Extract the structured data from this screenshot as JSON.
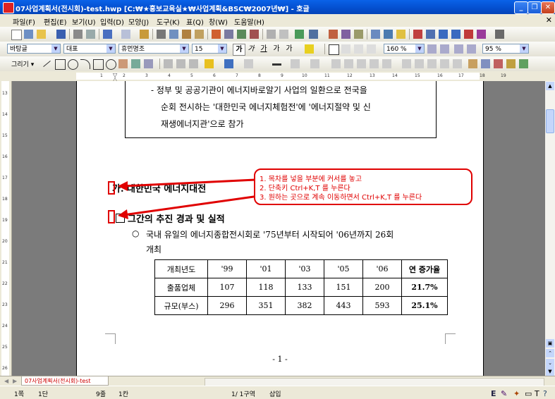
{
  "window": {
    "title": "07사업계획서(전시회)-test.hwp [C:₩★홍보교육실★₩사업계획&BSC₩2007년₩] - 호글"
  },
  "menu": [
    "파일(F)",
    "편집(E)",
    "보기(U)",
    "입력(D)",
    "모양(J)",
    "도구(K)",
    "표(Q)",
    "창(W)",
    "도움말(H)"
  ],
  "format_bar": {
    "style": "바탕글",
    "font_lang": "대표",
    "font_name": "휴먼명조",
    "font_size": "15",
    "line_spacing": "160 %",
    "zoom": "95 %"
  },
  "ruler_ticks": [
    "1",
    "2",
    "3",
    "4",
    "5",
    "6",
    "7",
    "8",
    "9",
    "10",
    "11",
    "12",
    "13",
    "14",
    "15",
    "16",
    "17",
    "18",
    "19"
  ],
  "vruler_ticks": [
    "13",
    "14",
    "15",
    "16",
    "17",
    "18",
    "19",
    "20",
    "21",
    "22",
    "23",
    "24",
    "25",
    "26"
  ],
  "document": {
    "box_text": [
      "- 정부 및 공공기관이 에너지바로알기 사업의 일환으로 전국을",
      "순회 전시하는 '대한민국 에너지체험전'에 '에너지절약 및 신",
      "재생에너지관'으로 참가"
    ],
    "heading_ga": "가. 대한민국 에너지대전",
    "heading_sub": "그간의 추진 경과 및 실적",
    "bullet": "○",
    "paragraph_line1": "국내 유일의 에너지종합전시회로 '75년부터 시작되어 '06년까지 26회",
    "paragraph_line2": "개최",
    "table": {
      "header": [
        "개최년도",
        "'99",
        "'01",
        "'03",
        "'05",
        "'06",
        "연 증가율"
      ],
      "rows": [
        [
          "출품업체",
          "107",
          "118",
          "133",
          "151",
          "200",
          "21.7%"
        ],
        [
          "규모(부스)",
          "296",
          "351",
          "382",
          "443",
          "593",
          "25.1%"
        ]
      ]
    },
    "page_number": "- 1 -"
  },
  "callout": {
    "lines": [
      "1. 목차를 넣을 부분에 커서를 놓고",
      "2. 단축키 Ctrl+K,T 를 누른다",
      "3. 원하는 곳으로 계속 이동하면서 Ctrl+K,T 를 누른다"
    ],
    "color": "#e00000"
  },
  "doc_tab": "07사업계획서(전시회)-test",
  "status": {
    "page": "1쪽",
    "section": "1단",
    "line": "9줄",
    "column": "1칸",
    "position": "1/ 1구역",
    "mode": "삽입"
  }
}
